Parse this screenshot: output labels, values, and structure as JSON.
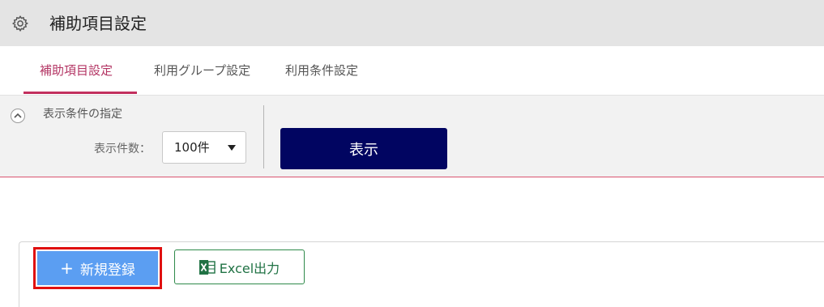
{
  "header": {
    "title": "補助項目設定",
    "icon": "gear-icon"
  },
  "tabs": [
    {
      "label": "補助項目設定",
      "active": true
    },
    {
      "label": "利用グループ設定",
      "active": false
    },
    {
      "label": "利用条件設定",
      "active": false
    }
  ],
  "filter": {
    "title": "表示条件の指定",
    "count_label": "表示件数：",
    "count_value": "100件",
    "show_button": "表示"
  },
  "actions": {
    "new_button": "新規登録",
    "excel_button": "Excel出力"
  },
  "colors": {
    "active_tab": "#b33463",
    "show_button_bg": "#010561",
    "new_button_bg": "#5b9ef2",
    "highlight_border": "#e01010",
    "excel_green": "#207244"
  }
}
